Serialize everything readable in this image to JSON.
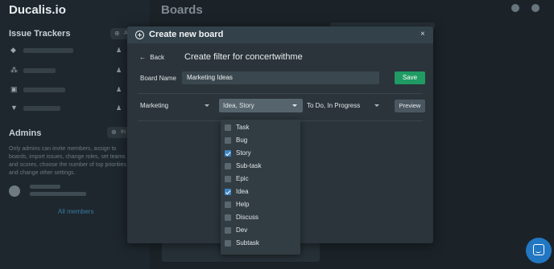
{
  "app": {
    "logo": "Ducalis.io",
    "page_title": "Boards"
  },
  "sidebar": {
    "issue_trackers_title": "Issue Trackers",
    "admins_title": "Admins",
    "admins_description": "Only admins can invite members, assign to boards, import issues, change roles, set teams and scores, choose the number of top priorities and change other settings.",
    "all_members_label": "All members",
    "add_tracker_label": "Add",
    "invite_label": "In"
  },
  "modal": {
    "title": "Create new board",
    "close_label": "×",
    "back_label": "Back",
    "subtitle": "Create filter for concertwithme",
    "board_name_label": "Board Name",
    "board_name_value": "Marketing Ideas",
    "save_label": "Save",
    "filter_project": "Marketing",
    "filter_types": "Idea, Story",
    "filter_statuses": "To Do, In Progress",
    "preview_label": "Preview"
  },
  "issue_type_options": [
    {
      "label": "Task",
      "checked": false
    },
    {
      "label": "Bug",
      "checked": false
    },
    {
      "label": "Story",
      "checked": true
    },
    {
      "label": "Sub-task",
      "checked": false
    },
    {
      "label": "Epic",
      "checked": false
    },
    {
      "label": "Idea",
      "checked": true
    },
    {
      "label": "Help",
      "checked": false
    },
    {
      "label": "Discuss",
      "checked": false
    },
    {
      "label": "Dev",
      "checked": false
    },
    {
      "label": "Subtask",
      "checked": false
    }
  ],
  "colors": {
    "accent_green": "#1f9b63",
    "accent_blue": "#3f86c4",
    "chat_blue": "#2277c2"
  }
}
